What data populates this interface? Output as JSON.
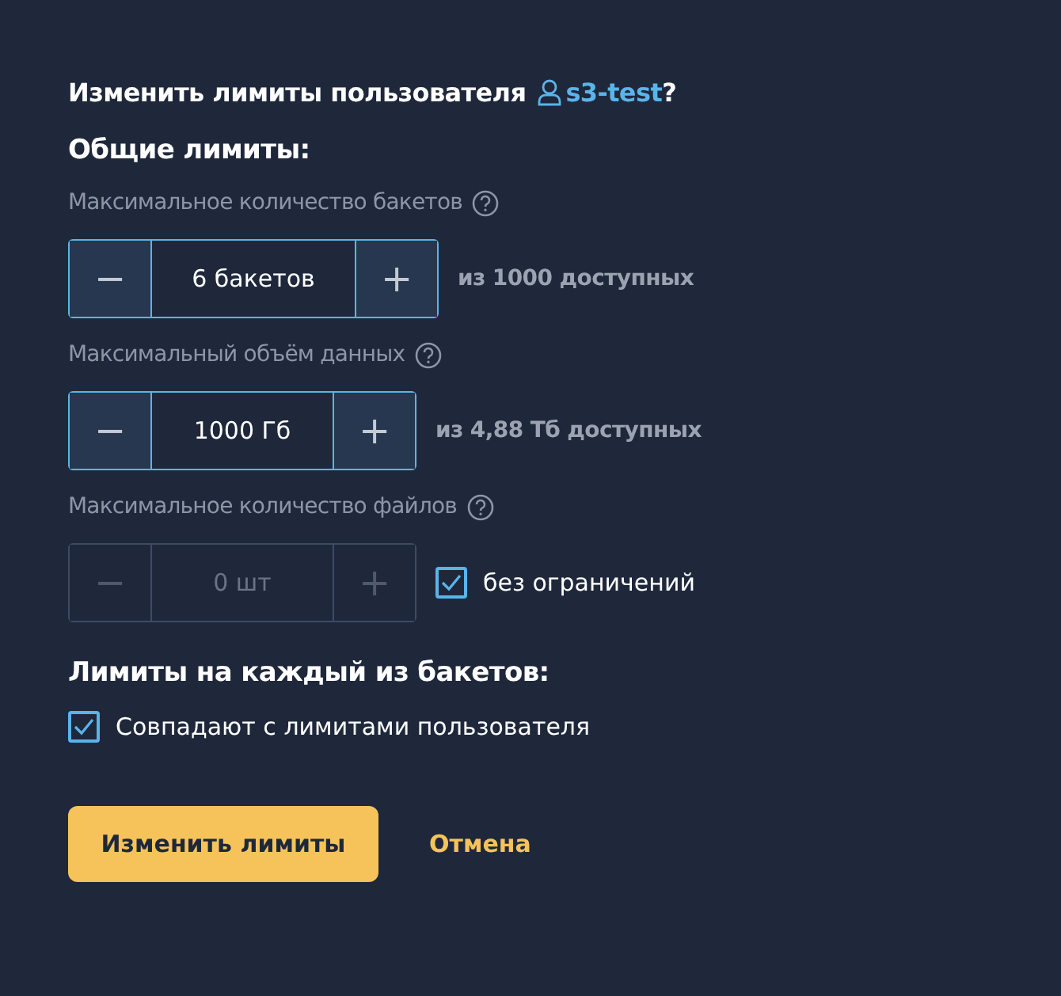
{
  "title": {
    "text": "Изменить лимиты пользователя",
    "user": "s3-test",
    "suffix": "?"
  },
  "general_heading": "Общие лимиты:",
  "limits": [
    {
      "label": "Максимальное количество бакетов",
      "minus": "−",
      "value": "6 бакетов",
      "plus": "+",
      "disabled": false,
      "wide": true,
      "kind": "note",
      "note": "из 1000 доступных"
    },
    {
      "label": "Максимальный объём данных",
      "minus": "−",
      "value": "1000 Гб",
      "plus": "+",
      "disabled": false,
      "wide": false,
      "kind": "note",
      "note": "из 4,88 Тб доступных"
    },
    {
      "label": "Максимальное количество файлов",
      "minus": "−",
      "value": "0 шт",
      "plus": "+",
      "disabled": true,
      "wide": false,
      "kind": "checkbox",
      "note": "без ограничений",
      "checked": true
    }
  ],
  "bucket_heading": "Лимиты на каждый из бакетов:",
  "same_limits": {
    "label": "Совпадают с лимитами пользователя",
    "checked": true
  },
  "buttons": {
    "submit": "Изменить лимиты",
    "cancel": "Отмена"
  }
}
